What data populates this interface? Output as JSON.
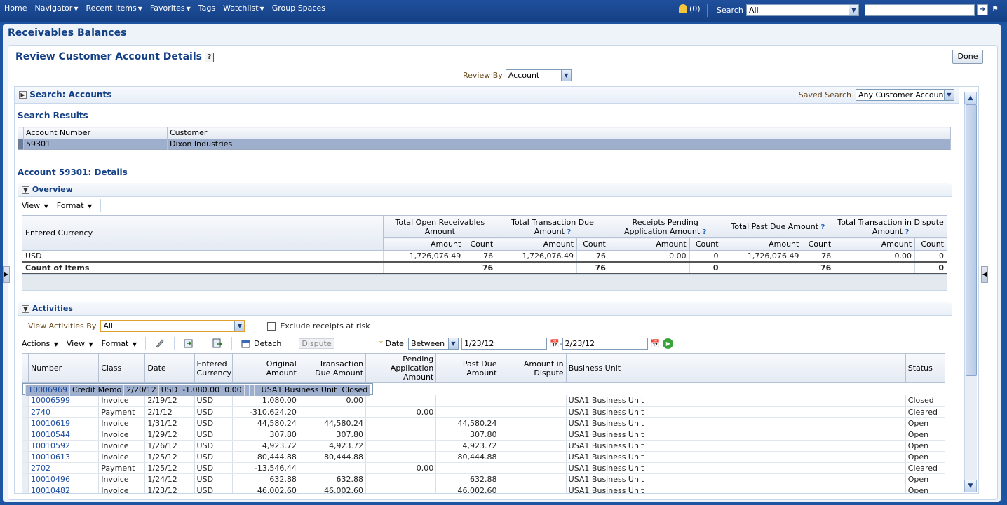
{
  "global": {
    "nav": [
      "Home",
      "Navigator",
      "Recent Items",
      "Favorites",
      "Tags",
      "Watchlist",
      "Group Spaces"
    ],
    "nav_has_menu": [
      false,
      true,
      true,
      true,
      false,
      true,
      false
    ],
    "notifications": "(0)",
    "search_label": "Search",
    "search_scope": "All"
  },
  "page": {
    "title": "Receivables Balances",
    "section_title": "Review Customer Account Details",
    "done_label": "Done",
    "review_by_label": "Review By",
    "review_by_value": "Account"
  },
  "search": {
    "title": "Search: Accounts",
    "saved_search_label": "Saved Search",
    "saved_search_value": "Any Customer Account"
  },
  "results": {
    "title": "Search Results",
    "columns": [
      "Account Number",
      "Customer"
    ],
    "rows": [
      [
        "59301",
        "Dixon Industries"
      ]
    ]
  },
  "account": {
    "title": "Account 59301: Details"
  },
  "overview": {
    "title": "Overview",
    "toolbar": {
      "view": "View",
      "format": "Format"
    },
    "col_currency": "Entered Currency",
    "groups": [
      {
        "label": "Total Open Receivables Amount",
        "help": false
      },
      {
        "label": "Total Transaction Due Amount",
        "help": true
      },
      {
        "label": "Receipts Pending Application Amount",
        "help": true
      },
      {
        "label": "Total Past Due Amount",
        "help": true
      },
      {
        "label": "Total Transaction in Dispute Amount",
        "help": true
      }
    ],
    "sub_amount": "Amount",
    "sub_count": "Count",
    "rows": [
      {
        "currency": "USD",
        "cells": [
          [
            "1,726,076.49",
            "76"
          ],
          [
            "1,726,076.49",
            "76"
          ],
          [
            "0.00",
            "0"
          ],
          [
            "1,726,076.49",
            "76"
          ],
          [
            "0.00",
            "0"
          ]
        ]
      }
    ],
    "total_label": "Count of Items",
    "totals": [
      "76",
      "76",
      "0",
      "76",
      "0"
    ]
  },
  "activities": {
    "title": "Activities",
    "view_by_label": "View Activities By",
    "view_by_value": "All",
    "exclude_label": "Exclude receipts at risk",
    "toolbar": {
      "actions": "Actions",
      "view": "View",
      "format": "Format",
      "detach": "Detach",
      "dispute": "Dispute"
    },
    "date_label": "Date",
    "date_op": "Between",
    "date_from": "1/23/12",
    "date_to": "2/23/12",
    "columns": [
      "Number",
      "Class",
      "Date",
      "Entered Currency",
      "Original Amount",
      "Transaction Due Amount",
      "Pending Application Amount",
      "Past Due Amount",
      "Amount in Dispute",
      "Business Unit",
      "Status"
    ],
    "rows": [
      [
        "10006969",
        "Credit Memo",
        "2/20/12",
        "USD",
        "-1,080.00",
        "0.00",
        "",
        "",
        "",
        "USA1 Business Unit",
        "Closed"
      ],
      [
        "10006599",
        "Invoice",
        "2/19/12",
        "USD",
        "1,080.00",
        "0.00",
        "",
        "",
        "",
        "USA1 Business Unit",
        "Closed"
      ],
      [
        "2740",
        "Payment",
        "2/1/12",
        "USD",
        "-310,624.20",
        "",
        "0.00",
        "",
        "",
        "USA1 Business Unit",
        "Cleared"
      ],
      [
        "10010619",
        "Invoice",
        "1/31/12",
        "USD",
        "44,580.24",
        "44,580.24",
        "",
        "44,580.24",
        "",
        "USA1 Business Unit",
        "Open"
      ],
      [
        "10010544",
        "Invoice",
        "1/29/12",
        "USD",
        "307.80",
        "307.80",
        "",
        "307.80",
        "",
        "USA1 Business Unit",
        "Open"
      ],
      [
        "10010592",
        "Invoice",
        "1/26/12",
        "USD",
        "4,923.72",
        "4,923.72",
        "",
        "4,923.72",
        "",
        "USA1 Business Unit",
        "Open"
      ],
      [
        "10010613",
        "Invoice",
        "1/25/12",
        "USD",
        "80,444.88",
        "80,444.88",
        "",
        "80,444.88",
        "",
        "USA1 Business Unit",
        "Open"
      ],
      [
        "2702",
        "Payment",
        "1/25/12",
        "USD",
        "-13,546.44",
        "",
        "0.00",
        "",
        "",
        "USA1 Business Unit",
        "Cleared"
      ],
      [
        "10010496",
        "Invoice",
        "1/24/12",
        "USD",
        "632.88",
        "632.88",
        "",
        "632.88",
        "",
        "USA1 Business Unit",
        "Open"
      ],
      [
        "10010482",
        "Invoice",
        "1/23/12",
        "USD",
        "46,002.60",
        "46,002.60",
        "",
        "46,002.60",
        "",
        "USA1 Business Unit",
        "Open"
      ]
    ]
  }
}
